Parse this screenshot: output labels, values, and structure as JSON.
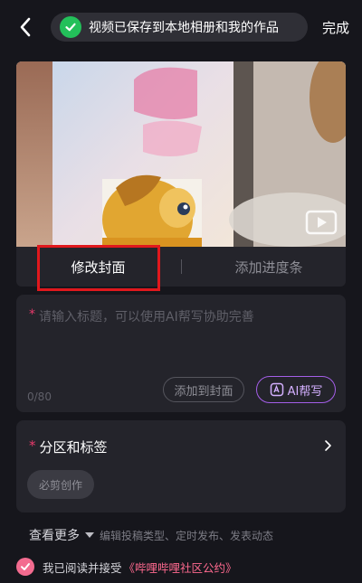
{
  "header": {
    "toast_text": "视频已保存到本地相册和我的作品",
    "done_label": "完成"
  },
  "preview": {
    "play_icon": "play-icon"
  },
  "cover_tabs": {
    "edit_cover_label": "修改封面",
    "add_progress_label": "添加进度条"
  },
  "title_card": {
    "required_mark": "*",
    "placeholder": "请输入标题，可以使用AI帮写协助完善",
    "char_count": "0/80",
    "add_to_cover_label": "添加到封面",
    "ai_help_label": "AI帮写"
  },
  "category_card": {
    "required_mark": "*",
    "title": "分区和标签",
    "tag_chip": "必剪创作"
  },
  "more": {
    "label": "查看更多",
    "description": "编辑投稿类型、定时发布、发表动态"
  },
  "agreement": {
    "text": "我已阅读并接受",
    "link": "《哔哩哔哩社区公约》"
  },
  "colors": {
    "background": "#16161c",
    "card": "#24242b",
    "accent_pink": "#ff6a8f",
    "success_green": "#23c05a",
    "ai_purple": "#a45ee8",
    "highlight_red": "#e0181d"
  }
}
